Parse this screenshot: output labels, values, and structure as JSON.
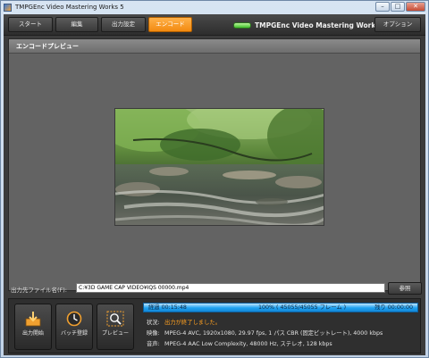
{
  "window": {
    "title": "TMPGEnc Video Mastering Works 5"
  },
  "titlebar_buttons": {
    "minimize": "–",
    "maximize": "□",
    "close": "✕"
  },
  "nav": {
    "start": "スタート",
    "edit": "編集",
    "output_settings": "出力設定",
    "encode": "エンコード",
    "brand": "TMPGEnc Video Mastering Works 5",
    "option": "オプション"
  },
  "panel": {
    "title": "エンコードプレビュー"
  },
  "output_file": {
    "label": "出力先ファイル名(F):",
    "value": "C:¥3D GAME CAP VIDEO¥IQS 00000.mp4",
    "browse": "参照"
  },
  "actions": {
    "start_output": "出力開始",
    "batch_register": "バッチ登録",
    "preview": "プレビュー"
  },
  "progress": {
    "elapsed": "経過 00:15:48",
    "frames": "100% ( 45055/45055 フレーム )",
    "remaining": "残り 00:00:00",
    "percent": 100
  },
  "info": {
    "status_label": "状況:",
    "status_value": "出力が終了しました。",
    "video_label": "映像:",
    "video_value": "MPEG-4 AVC, 1920x1080, 29.97 fps, 1 パス CBR (固定ビットレート), 4000 kbps",
    "audio_label": "音声:",
    "audio_value": "MPEG-4 AAC Low Complexity, 48000 Hz, ステレオ, 128 kbps"
  },
  "colors": {
    "accent": "#f28a10",
    "progress": "#1ea1ef",
    "status_text": "#ffa020"
  }
}
